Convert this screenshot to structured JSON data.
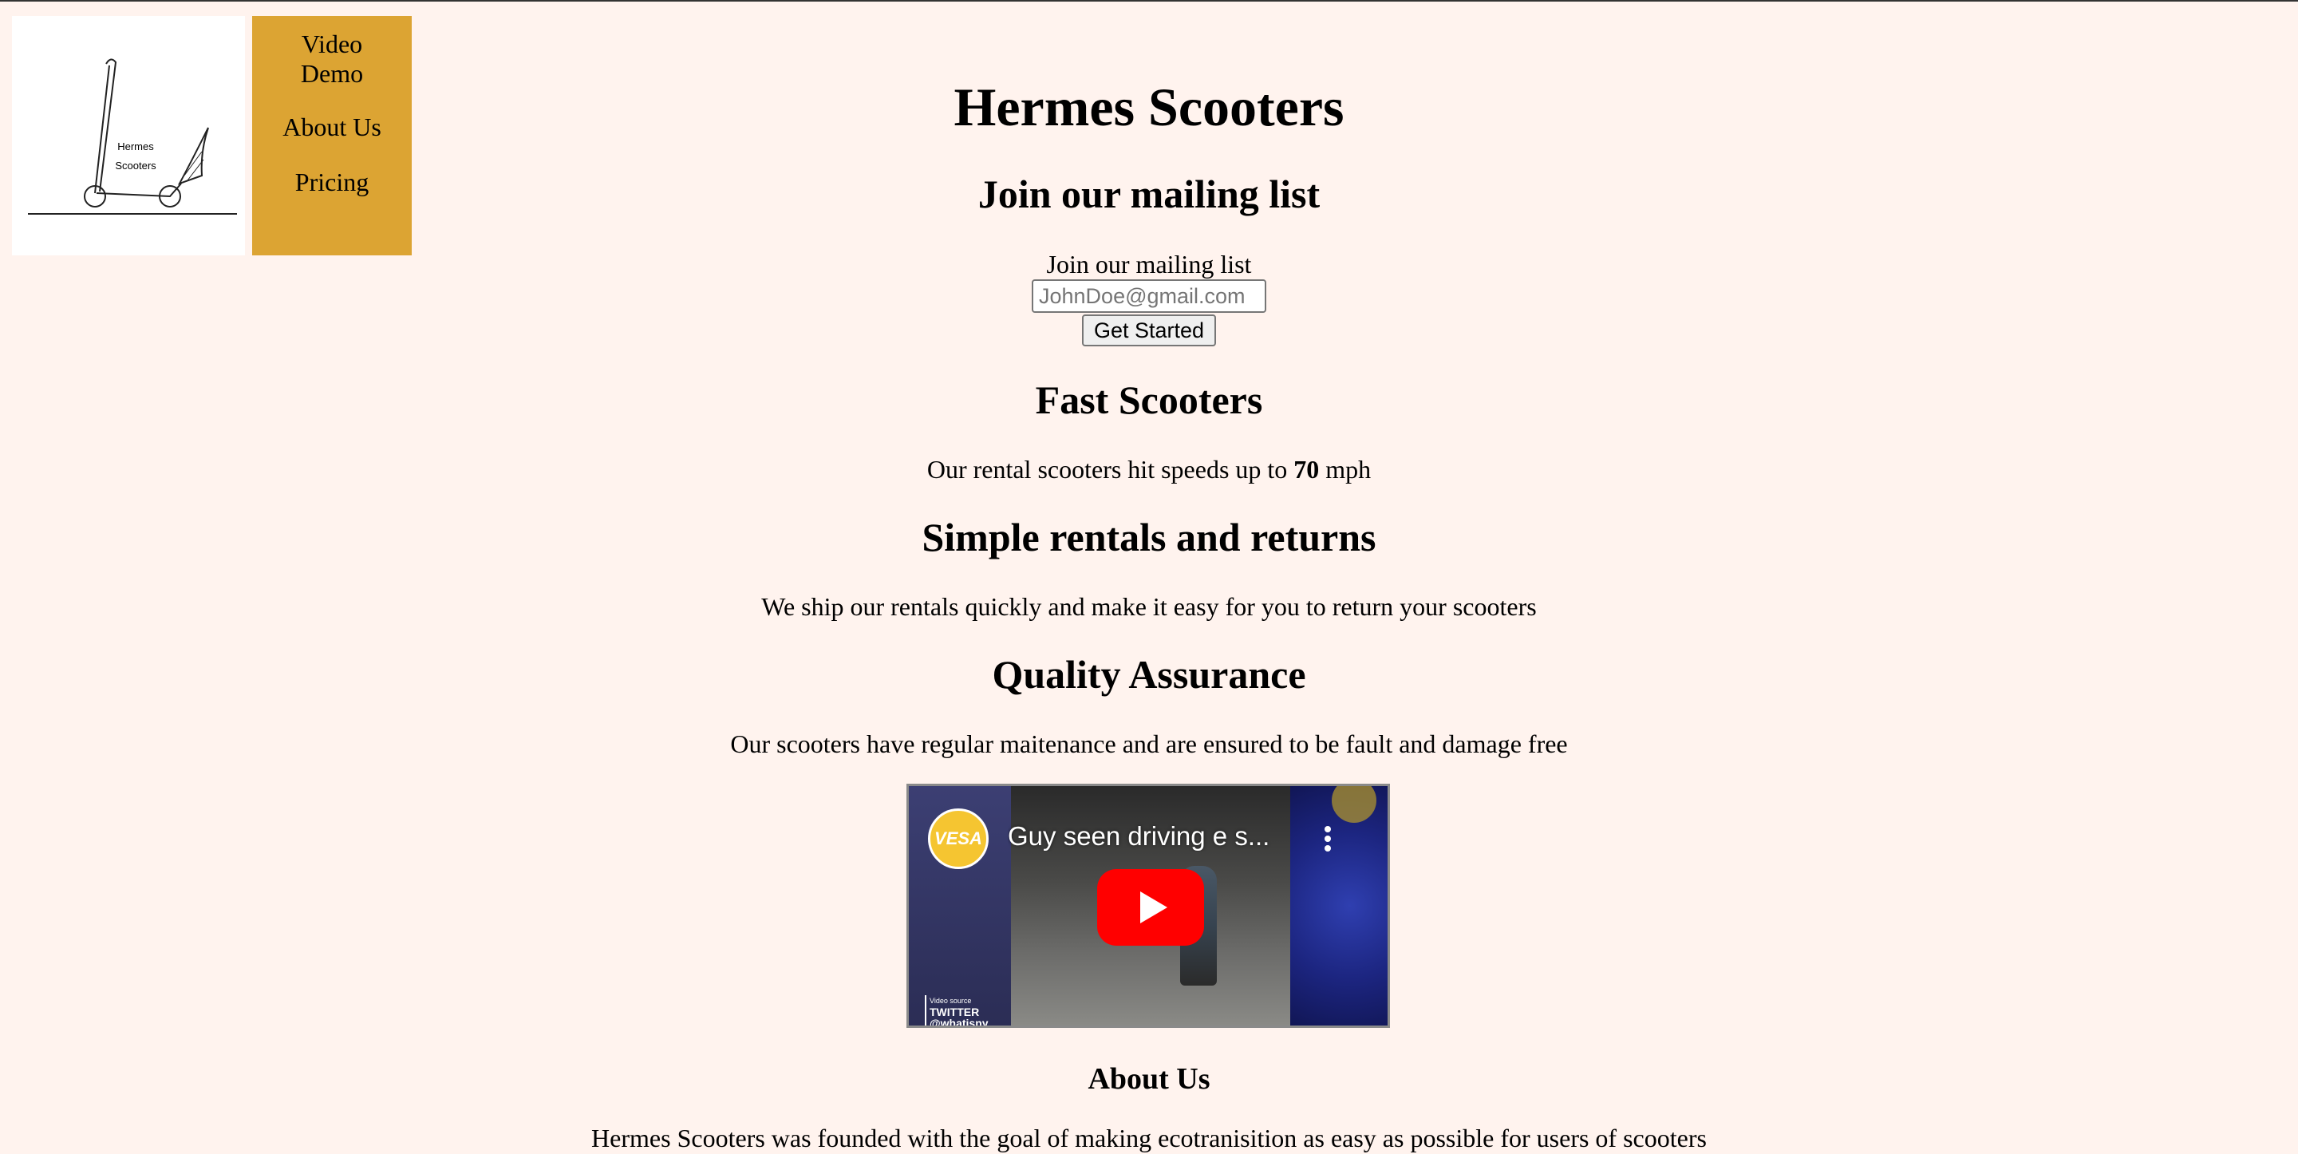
{
  "logo": {
    "line1": "Hermes",
    "line2": "Scooters"
  },
  "nav": {
    "items": [
      {
        "label": "Video Demo"
      },
      {
        "label": "About Us"
      },
      {
        "label": "Pricing"
      }
    ]
  },
  "header": {
    "title": "Hermes Scooters"
  },
  "mailing": {
    "heading": "Join our mailing list",
    "label": "Join our mailing list",
    "placeholder": "JohnDoe@gmail.com",
    "button": "Get Started"
  },
  "features": [
    {
      "heading": "Fast Scooters",
      "text_before": "Our rental scooters hit speeds up to ",
      "bold": "70",
      "text_after": " mph"
    },
    {
      "heading": "Simple rentals and returns",
      "text": "We ship our rentals quickly and make it easy for you to return your scooters"
    },
    {
      "heading": "Quality Assurance",
      "text": "Our scooters have regular maitenance and are ensured to be fault and damage free"
    }
  ],
  "video": {
    "title": "Guy seen driving e s...",
    "channel": "VESA",
    "source_label": "Video source",
    "source_line1": "TWITTER",
    "source_line2": "@whatisny"
  },
  "about": {
    "heading": "About Us",
    "text": "Hermes Scooters was founded with the goal of making ecotranisition as easy as possible for users of scooters"
  },
  "colors": {
    "background": "#fff3ee",
    "nav": "#dca433",
    "play": "#ff0000"
  }
}
